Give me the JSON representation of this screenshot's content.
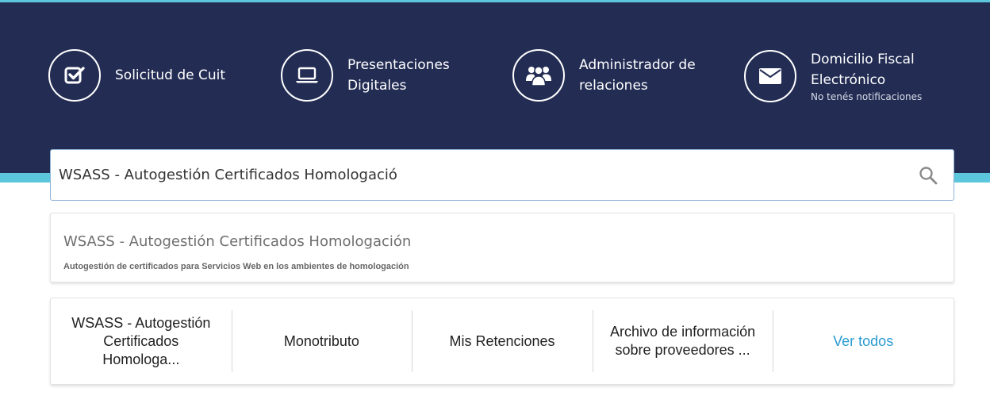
{
  "shortcuts": [
    {
      "label_line1": "Solicitud de Cuit",
      "label_line2": "",
      "icon": "checkbox-icon"
    },
    {
      "label_line1": "Presentaciones",
      "label_line2": "Digitales",
      "icon": "laptop-icon"
    },
    {
      "label_line1": "Administrador de",
      "label_line2": "relaciones",
      "icon": "users-icon"
    },
    {
      "label_line1": "Domicilio Fiscal",
      "label_line2": "Electrónico",
      "sub": "No tenés notificaciones",
      "icon": "envelope-icon"
    }
  ],
  "search": {
    "value": "WSASS - Autogestión Certificados Homologació",
    "icon": "search-icon"
  },
  "suggestion": {
    "title": "WSASS - Autogestión Certificados Homologación",
    "description": "Autogestión de certificados para Servicios Web en los ambientes de homologación"
  },
  "recent": [
    {
      "line1": "WSASS - Autogestión",
      "line2": "Certificados",
      "line3": "Homologa..."
    },
    {
      "line1": "Monotributo"
    },
    {
      "line1": "Mis Retenciones"
    },
    {
      "line1": "Archivo de información",
      "line2": "sobre proveedores ..."
    },
    {
      "line1": "Ver todos"
    }
  ],
  "colors": {
    "header_bg": "#232d54",
    "accent": "#5cc7dc",
    "link": "#2a9bd3"
  }
}
